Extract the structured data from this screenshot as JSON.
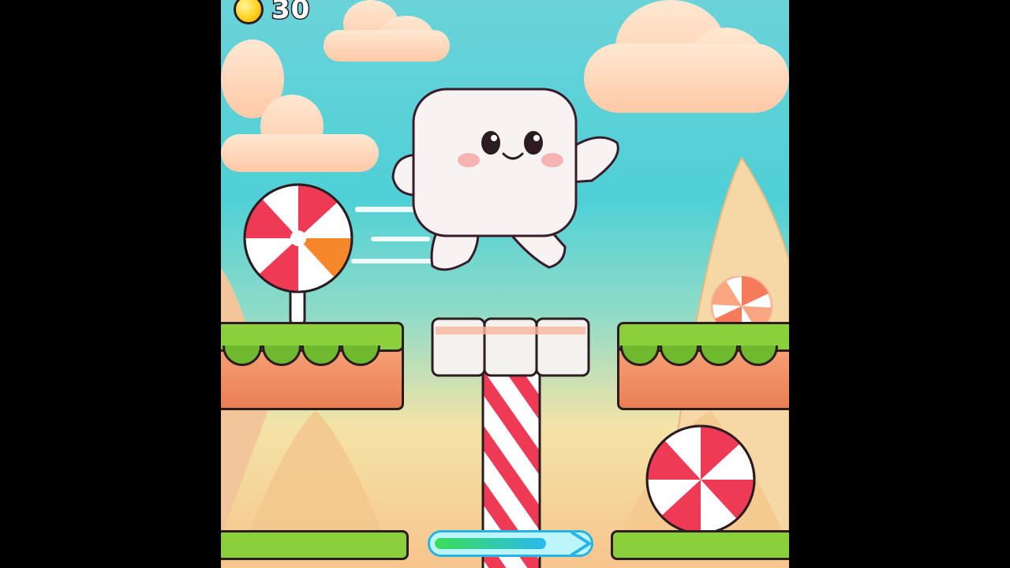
{
  "hud": {
    "coin_icon": "coin-icon",
    "score": "30"
  },
  "scene": {
    "player": "marshmallow-character",
    "controls": {
      "move_right_arrow_progress": 0.72
    }
  },
  "colors": {
    "sky_top": "#6ad3d9",
    "grass": "#8ad03a",
    "dirt": "#ea7f52",
    "candy_red": "#ef3a55",
    "outline": "#2b1c22"
  }
}
